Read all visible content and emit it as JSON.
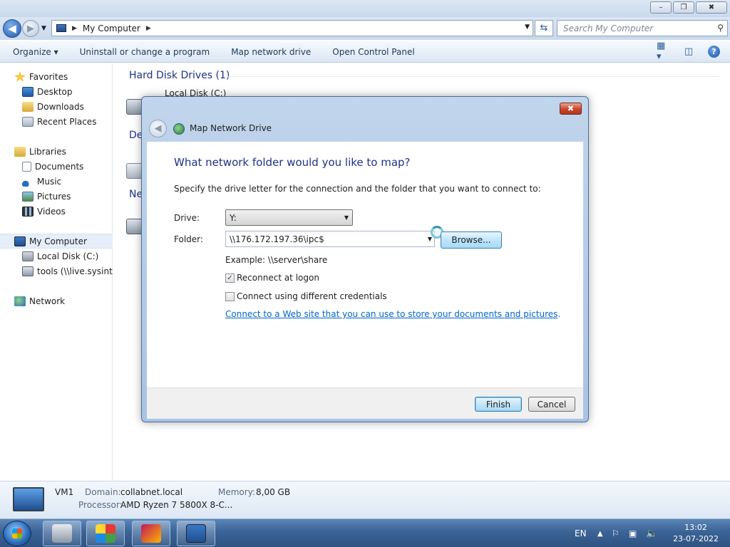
{
  "window": {
    "min_glyph": "–",
    "max_glyph": "❐",
    "close_glyph": "✖"
  },
  "address": {
    "path": "My Computer",
    "search_placeholder": "Search My Computer"
  },
  "toolbar": {
    "items": [
      "Organize ▾",
      "Uninstall or change a program",
      "Map network drive",
      "Open Control Panel"
    ],
    "help_glyph": "?"
  },
  "nav": {
    "favorites": "Favorites",
    "desktop": "Desktop",
    "downloads": "Downloads",
    "recent": "Recent Places",
    "libraries": "Libraries",
    "documents": "Documents",
    "music": "Music",
    "pictures": "Pictures",
    "videos": "Videos",
    "computer": "My Computer",
    "local_disk": "Local Disk (C:)",
    "tools": "tools (\\\\live.sysinternals.com)",
    "network": "Network"
  },
  "content": {
    "hdd_group": "Hard Disk Drives (1)",
    "local_disk": "Local Disk (C:)",
    "devices_group_partial": "De",
    "network_group_partial": "Ne"
  },
  "details": {
    "name": "VM1",
    "domain_label": "Domain:",
    "domain_value": "collabnet.local",
    "memory_label": "Memory:",
    "memory_value": "8,00 GB",
    "processor_label": "Processor:",
    "processor_value": "AMD Ryzen 7 5800X 8-C..."
  },
  "dialog": {
    "title": "Map Network Drive",
    "heading": "What network folder would you like to map?",
    "instruction": "Specify the drive letter for the connection and the folder that you want to connect to:",
    "drive_label": "Drive:",
    "drive_value": "Y:",
    "folder_label": "Folder:",
    "folder_value": "\\\\176.172.197.36\\ipc$",
    "browse_label": "Browse...",
    "example": "Example: \\\\server\\share",
    "reconnect_label": "Reconnect at logon",
    "reconnect_checked": true,
    "credentials_label": "Connect using different credentials",
    "credentials_checked": false,
    "link_text": "Connect to a Web site that you can use to store your documents and pictures",
    "link_suffix": ".",
    "finish_label": "Finish",
    "cancel_label": "Cancel",
    "close_glyph": "✖"
  },
  "taskbar": {
    "language": "EN",
    "time": "13:02",
    "date": "23-07-2022"
  },
  "colors": {
    "heading_blue": "#1e3287",
    "link_blue": "#0066cc",
    "taskbar": "#3b6396",
    "close_red": "#c9442c"
  },
  "icons": {
    "back": "left-arrow-icon",
    "forward": "right-arrow-icon",
    "refresh": "refresh-icon",
    "search": "search-icon",
    "help": "help-icon"
  }
}
